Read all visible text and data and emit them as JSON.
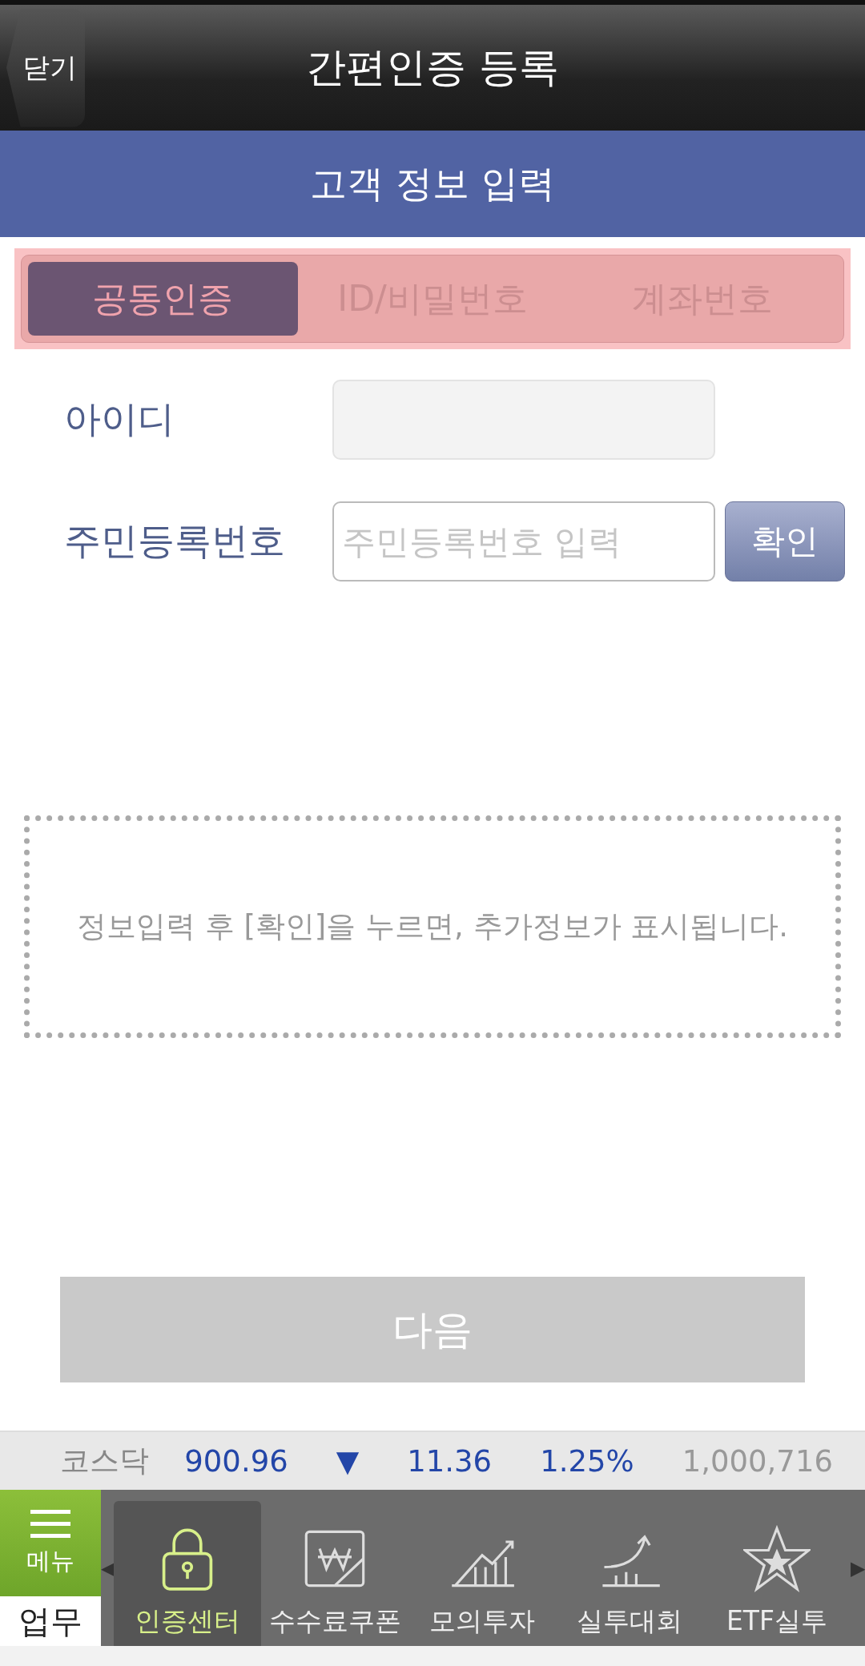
{
  "header": {
    "close": "닫기",
    "title": "간편인증 등록"
  },
  "section_title": "고객 정보 입력",
  "tabs": [
    {
      "label": "공동인증",
      "selected": true
    },
    {
      "label": "ID/비밀번호",
      "selected": false
    },
    {
      "label": "계좌번호",
      "selected": false
    }
  ],
  "form": {
    "id_label": "아이디",
    "id_disabled": true,
    "rrn_label": "주민등록번호",
    "rrn_placeholder": "주민등록번호 입력",
    "confirm": "확인"
  },
  "notice": "정보입력 후 [확인]을 누르면, 추가정보가 표시됩니다.",
  "next_button": {
    "label": "다음",
    "disabled": true
  },
  "ticker": {
    "name": "코스닥",
    "value": "900.96",
    "arrow": "▼",
    "change": "11.36",
    "percent": "1.25%",
    "volume": "1,000,716"
  },
  "nav": {
    "menu": "메뉴",
    "work": "업무",
    "left_arrow": "◀",
    "right_arrow": "▶",
    "items": [
      {
        "label": "인증센터",
        "kind": "lock",
        "selected": true
      },
      {
        "label": "수수료쿠폰",
        "kind": "coupon",
        "selected": false
      },
      {
        "label": "모의투자",
        "kind": "chart",
        "selected": false
      },
      {
        "label": "실투대회",
        "kind": "growth",
        "selected": false
      },
      {
        "label": "ETF실투",
        "kind": "star",
        "selected": false
      }
    ]
  }
}
